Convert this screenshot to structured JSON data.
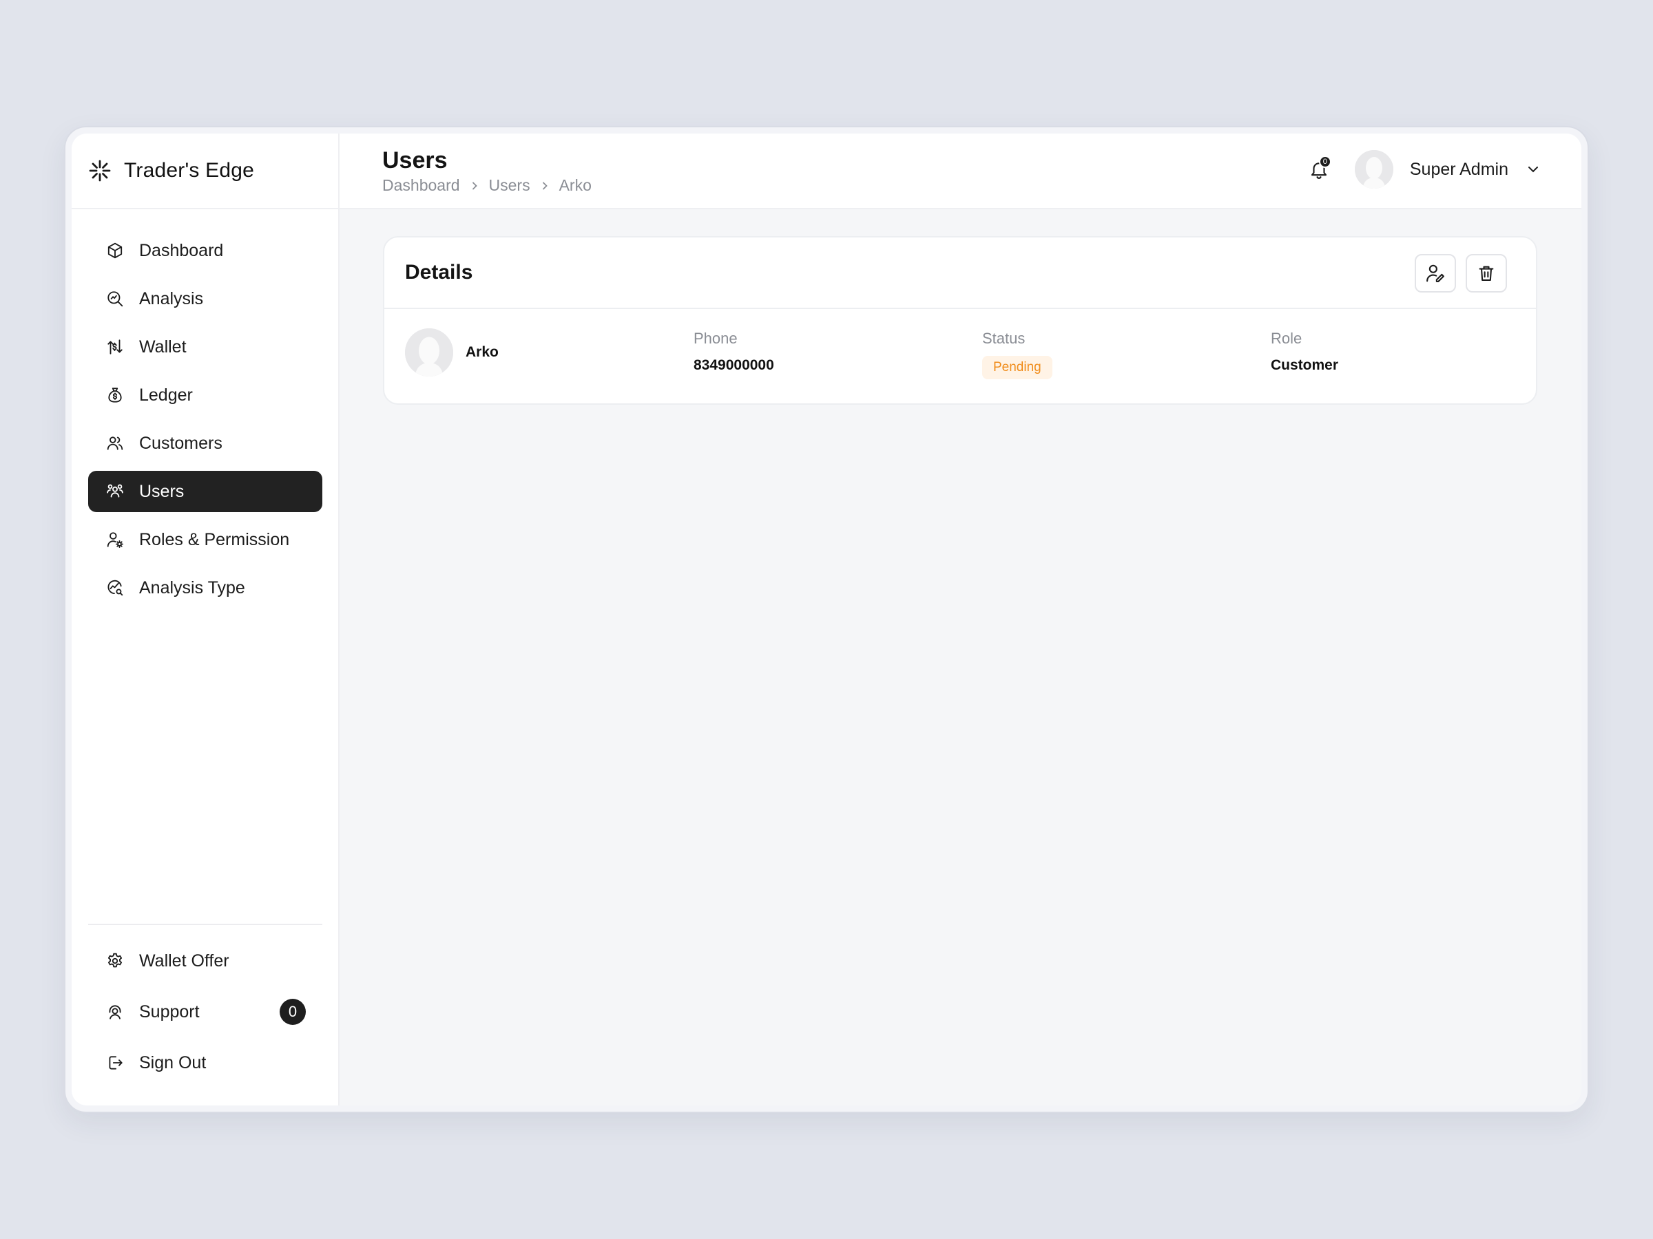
{
  "app": {
    "name": "Trader's Edge"
  },
  "sidebar": {
    "items": [
      {
        "label": "Dashboard",
        "icon": "cube-icon"
      },
      {
        "label": "Analysis",
        "icon": "analysis-search-icon"
      },
      {
        "label": "Wallet",
        "icon": "wallet-transfer-icon"
      },
      {
        "label": "Ledger",
        "icon": "money-bag-icon"
      },
      {
        "label": "Customers",
        "icon": "customers-icon"
      },
      {
        "label": "Users",
        "icon": "users-group-icon",
        "active": true
      },
      {
        "label": "Roles & Permission",
        "icon": "user-settings-icon"
      },
      {
        "label": "Analysis Type",
        "icon": "chart-search-icon"
      }
    ],
    "bottom_items": [
      {
        "label": "Wallet Offer",
        "icon": "gear-icon"
      },
      {
        "label": "Support",
        "icon": "support-icon",
        "badge": "0"
      },
      {
        "label": "Sign Out",
        "icon": "sign-out-icon"
      }
    ]
  },
  "header": {
    "title": "Users",
    "breadcrumb": [
      "Dashboard",
      "Users",
      "Arko"
    ],
    "notification_count": "0",
    "user_name": "Super Admin"
  },
  "details": {
    "title": "Details",
    "name": "Arko",
    "phone_label": "Phone",
    "phone": "8349000000",
    "status_label": "Status",
    "status": "Pending",
    "role_label": "Role",
    "role": "Customer"
  },
  "colors": {
    "accent": "#222222",
    "status_pending_text": "#f08c1a",
    "status_pending_bg": "#fff3e6",
    "page_bg": "#f5f6f8"
  }
}
